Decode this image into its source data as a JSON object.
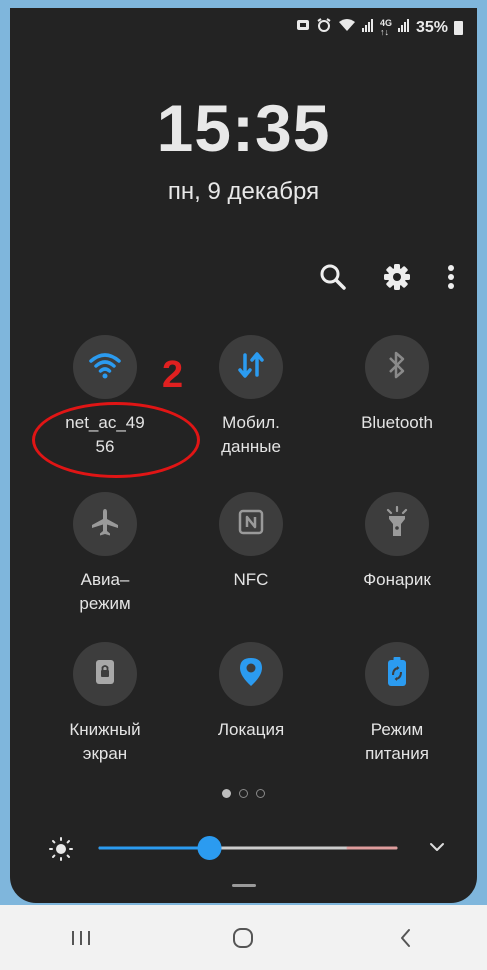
{
  "status_bar": {
    "battery_percent": "35%",
    "icons": [
      "screenshot-icon",
      "alarm-icon",
      "wifi-icon",
      "signal-icon",
      "4g-icon",
      "signal-icon",
      "battery-icon"
    ]
  },
  "lock": {
    "time": "15:35",
    "date": "пн, 9 декабря"
  },
  "top_actions": [
    "search-icon",
    "gear-icon",
    "more-vert-icon"
  ],
  "tiles": [
    {
      "label": "net_ac_49\n56",
      "icon": "wifi-icon",
      "active": true
    },
    {
      "label": "Мобил.\nданные",
      "icon": "mobile-data-icon",
      "active": true
    },
    {
      "label": "Bluetooth",
      "icon": "bluetooth-icon",
      "active": false
    },
    {
      "label": "Авиа–\nрежим",
      "icon": "airplane-icon",
      "active": false
    },
    {
      "label": "NFC",
      "icon": "nfc-icon",
      "active": false
    },
    {
      "label": "Фонарик",
      "icon": "flashlight-icon",
      "active": false
    },
    {
      "label": "Книжный\nэкран",
      "icon": "portrait-lock-icon",
      "active": false
    },
    {
      "label": "Локация",
      "icon": "location-icon",
      "active": true
    },
    {
      "label": "Режим\nпитания",
      "icon": "power-mode-icon",
      "active": true
    }
  ],
  "annotation": {
    "number": "2"
  },
  "pager": {
    "pages": 3,
    "current": 1
  },
  "brightness": {
    "level": 0.37
  },
  "colors": {
    "accent": "#2196f3",
    "panel": "#232323",
    "tile_bg": "#3d3d3d",
    "annotation": "#e01515"
  },
  "nav": [
    "recent-apps-icon",
    "home-icon",
    "back-icon"
  ]
}
